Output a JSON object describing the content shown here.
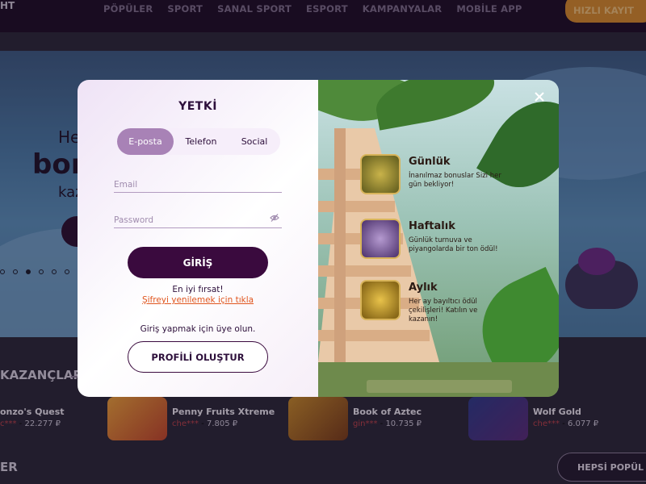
{
  "nav": {
    "logo": "HT",
    "items": [
      "PÖPÜLER",
      "SPORT",
      "SANAL SPORT",
      "ESPORT",
      "KAMPANYALAR",
      "MOBİLE APP"
    ],
    "register_label": "HIZLI KAYIT"
  },
  "hero": {
    "line1": "He",
    "line2": "bon",
    "line3": "kaz"
  },
  "wins": {
    "title": "KAZANÇLAR",
    "items": [
      {
        "name": "onzo's Quest",
        "user": "c***",
        "amount": "22.277 ₽"
      },
      {
        "name": "Penny Fruits Xtreme",
        "user": "che***",
        "amount": "7.805 ₽"
      },
      {
        "name": "Book of Aztec",
        "user": "gin***",
        "amount": "10.735 ₽"
      },
      {
        "name": "Wolf Gold",
        "user": "che***",
        "amount": "6.077 ₽"
      }
    ]
  },
  "section2": {
    "title": "ER",
    "all_label": "HEPSİ POPÜL"
  },
  "modal": {
    "title": "YETKİ",
    "tabs": [
      "E-posta",
      "Telefon",
      "Social"
    ],
    "active_tab": "E-posta",
    "email_placeholder": "Email",
    "password_placeholder": "Password",
    "login_label": "GİRİŞ",
    "offer_text": "En iyi fırsat!",
    "renew_link": "Şifreyi yenilemek için tıkla",
    "join_text": "Giriş yapmak için üye olun.",
    "create_label": "PROFİLİ OLUŞTUR",
    "promos": [
      {
        "title": "Günlük",
        "desc": "İnanılmaz bonuslar Sizi her gün bekliyor!",
        "icon": "gold-mask-icon"
      },
      {
        "title": "Haftalık",
        "desc": "Günlük turnuva ve piyangolarda bir ton ödül!",
        "icon": "purple-mask-icon"
      },
      {
        "title": "Aylık",
        "desc": "Her ay bayıltıcı ödül çekilişleri! Katılın ve kazanın!",
        "icon": "gold-coin-icon"
      }
    ]
  },
  "colors": {
    "accent": "#3a0a3e",
    "tab_active": "#a882b6",
    "link": "#e0561f",
    "brand_orange": "#d98a2c"
  }
}
